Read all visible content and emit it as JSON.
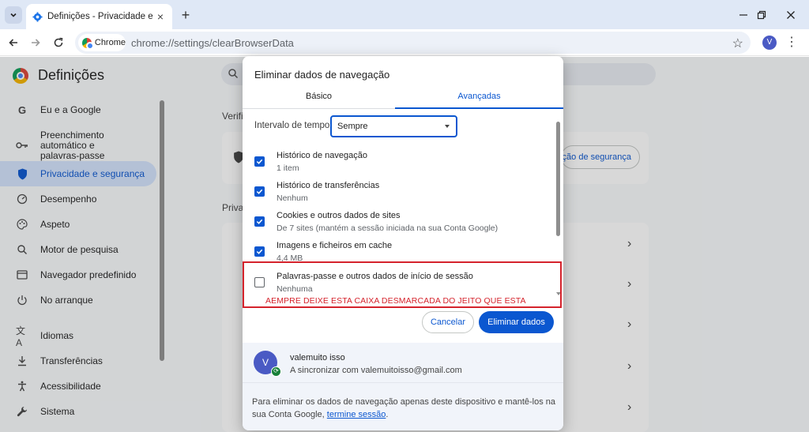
{
  "browser": {
    "tab_title": "Definições - Privacidade e segu",
    "chip_label": "Chrome",
    "url": "chrome://settings/clearBrowserData",
    "profile_initial": "V"
  },
  "settings": {
    "title": "Definições",
    "sidebar": [
      {
        "label": "Eu e a Google",
        "icon": "google-g-icon"
      },
      {
        "label": "Preenchimento automático e palavras-passe",
        "icon": "key-icon"
      },
      {
        "label": "Privacidade e segurança",
        "icon": "shield-icon"
      },
      {
        "label": "Desempenho",
        "icon": "speedometer-icon"
      },
      {
        "label": "Aspeto",
        "icon": "palette-icon"
      },
      {
        "label": "Motor de pesquisa",
        "icon": "search-icon"
      },
      {
        "label": "Navegador predefinido",
        "icon": "browser-window-icon"
      },
      {
        "label": "No arranque",
        "icon": "power-icon"
      },
      {
        "label": "Idiomas",
        "icon": "translate-icon"
      },
      {
        "label": "Transferências",
        "icon": "download-icon"
      },
      {
        "label": "Acessibilidade",
        "icon": "accessibility-icon"
      },
      {
        "label": "Sistema",
        "icon": "wrench-icon"
      }
    ],
    "bg_section_1": "Verifi",
    "bg_section_2": "Priva",
    "bg_button": "ção de segurança"
  },
  "dialog": {
    "title": "Eliminar dados de navegação",
    "tabs": [
      "Básico",
      "Avançadas"
    ],
    "time_range_label": "Intervalo de tempo",
    "time_range_value": "Sempre",
    "options": [
      {
        "title": "Histórico de navegação",
        "sub": "1 item",
        "checked": true
      },
      {
        "title": "Histórico de transferências",
        "sub": "Nenhum",
        "checked": true
      },
      {
        "title": "Cookies e outros dados de sites",
        "sub": "De 7 sites (mantém a sessão iniciada na sua Conta Google)",
        "checked": true
      },
      {
        "title": "Imagens e ficheiros em cache",
        "sub": "4,4 MB",
        "checked": true
      },
      {
        "title": "Palavras-passe e outros dados de início de sessão",
        "sub": "Nenhuma",
        "checked": false
      }
    ],
    "warning": "AEMPRE DEIXE ESTA CAIXA DESMARCADA DO JEITO QUE ESTA",
    "cancel_label": "Cancelar",
    "delete_label": "Eliminar dados",
    "account": {
      "initial": "V",
      "name": "valemuito isso",
      "sync_text": "A sincronizar com valemuitoisso@gmail.com"
    },
    "footer_text": "Para eliminar os dados de navegação apenas deste dispositivo e mantê-los na sua Conta Google, ",
    "footer_link": "termine sessão",
    "footer_end": "."
  },
  "colors": {
    "accent": "#0b57d0",
    "warning": "#d5232c",
    "sidebar_active": "#d3e3fd"
  }
}
